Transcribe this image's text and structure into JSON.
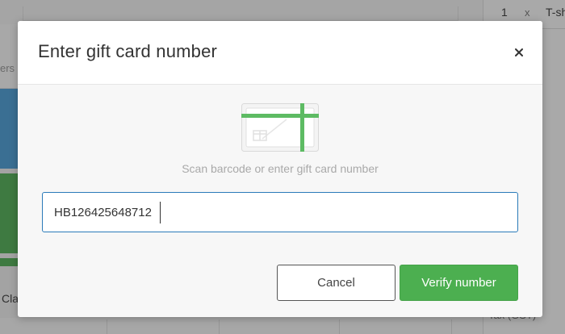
{
  "background": {
    "filter_text": "ers",
    "tile_label": "Cla",
    "cart": {
      "qty": "1",
      "times": "x",
      "item": "T-sh",
      "tax": "Tax (GST)"
    }
  },
  "modal": {
    "title": "Enter gift card number",
    "close_icon": "close-icon",
    "illustration_icon": "gift-card-barcode-icon",
    "hint": "Scan barcode or enter gift card number",
    "input_value": "HB126425648712",
    "cancel_label": "Cancel",
    "verify_label": "Verify number"
  },
  "colors": {
    "accent_green": "#4caf50",
    "input_border": "#2b7bb9",
    "tile_blue": "#3a6f93",
    "tile_green": "#3e7a41"
  }
}
